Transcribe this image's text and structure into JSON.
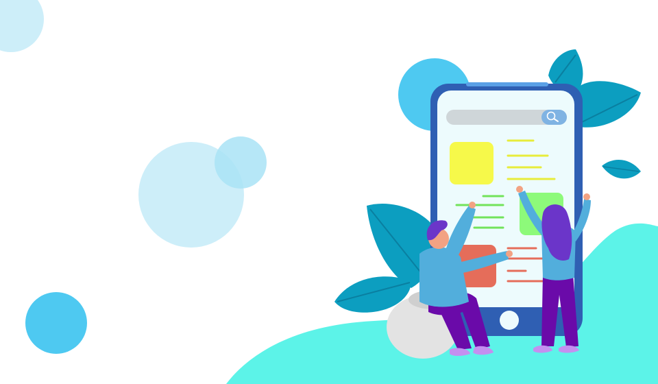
{
  "scene": {
    "description_free": true,
    "colors": {
      "background": "#ffffff",
      "bubble_light": "#cdeef9",
      "bubble_mid": "#4ec9f1",
      "ground": "#5cf3e8",
      "leaf": "#0c9ec0",
      "leaf_dark": "#0a7fa0",
      "phone_frame": "#2f5fb3",
      "phone_screen": "#edfbfd",
      "search_bar": "#cfd6d9",
      "search_button": "#7fb3e3",
      "card_yellow": "#f6f94a",
      "card_green": "#8dfa7a",
      "card_orange": "#e56d5a",
      "line_yellow": "#e7ec3a",
      "line_green": "#72e35a",
      "line_orange": "#e56d5a",
      "shirt_blue": "#52aedc",
      "pants_purple": "#6a0aa9",
      "hair_purple": "#6b35c9",
      "shoe_pink": "#c48ff0",
      "skin": "#f2a283",
      "stone": "#e3e3e3"
    },
    "icons": {
      "search": "search-icon",
      "home_button": "home-button-icon"
    }
  }
}
